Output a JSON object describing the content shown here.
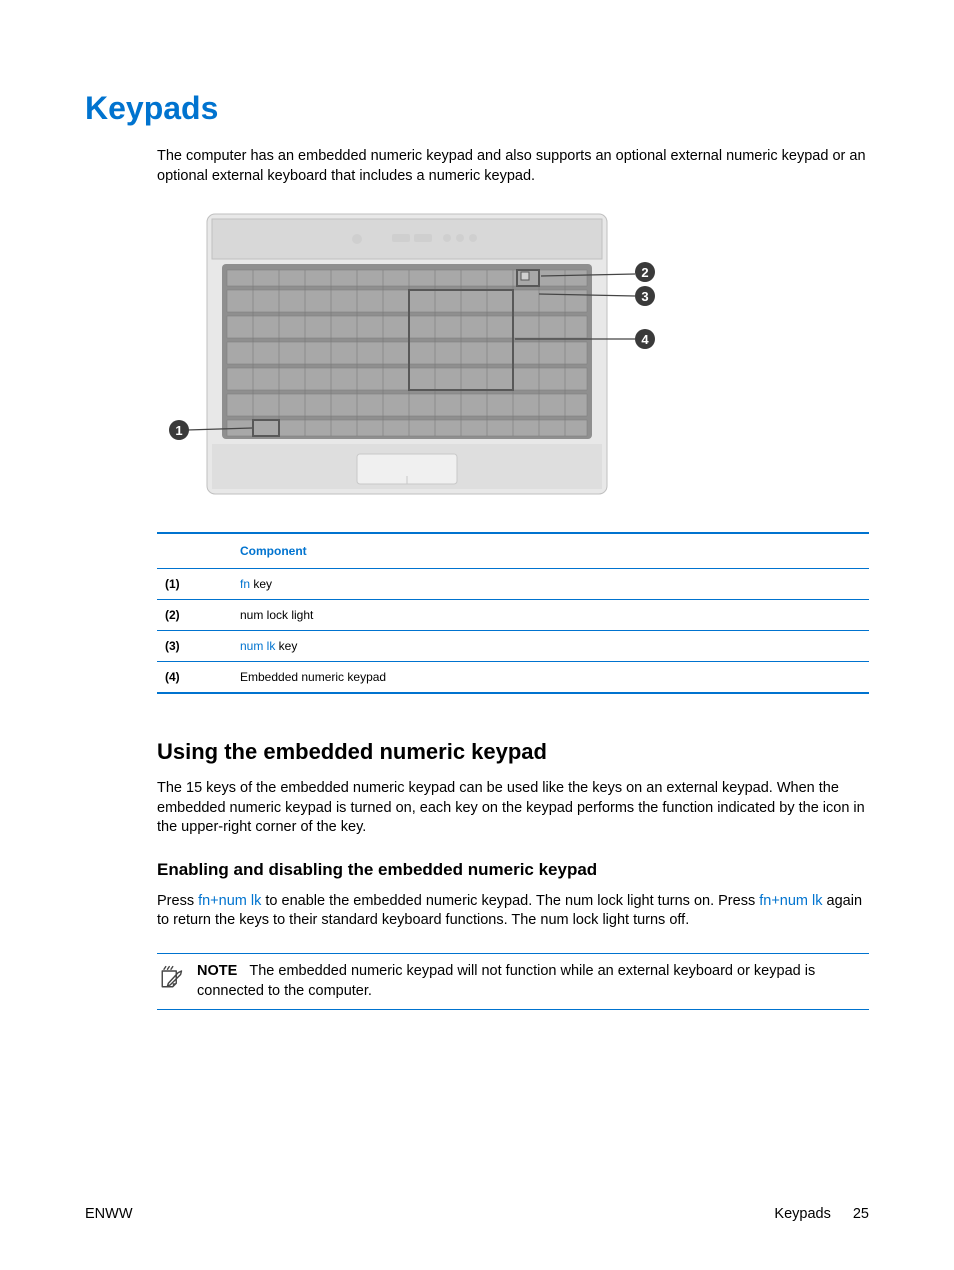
{
  "title": "Keypads",
  "intro": "The computer has an embedded numeric keypad and also supports an optional external numeric keypad or an optional external keyboard that includes a numeric keypad.",
  "table": {
    "header_blank": "",
    "header_component": "Component",
    "rows": [
      {
        "num": "(1)",
        "component_blue": "fn",
        "component_rest": " key"
      },
      {
        "num": "(2)",
        "component_blue": "",
        "component_rest": "num lock light"
      },
      {
        "num": "(3)",
        "component_blue": "num lk",
        "component_rest": " key"
      },
      {
        "num": "(4)",
        "component_blue": "",
        "component_rest": "Embedded numeric keypad"
      }
    ]
  },
  "h2": "Using the embedded numeric keypad",
  "p2": "The 15 keys of the embedded numeric keypad can be used like the keys on an external keypad. When the embedded numeric keypad is turned on, each key on the keypad performs the function indicated by the icon in the upper-right corner of the key.",
  "h3": "Enabling and disabling the embedded numeric keypad",
  "p3_parts": {
    "a": "Press ",
    "b": "fn+num lk",
    "c": " to enable the embedded numeric keypad. The num lock light turns on. Press ",
    "d": "fn+num lk",
    "e": " again to return the keys to their standard keyboard functions. The num lock light turns off."
  },
  "note": {
    "label": "NOTE",
    "text": "The embedded numeric keypad will not function while an external keyboard or keypad is connected to the computer."
  },
  "footer": {
    "left": "ENWW",
    "right_label": "Keypads",
    "page": "25"
  },
  "callouts": {
    "c1": "1",
    "c2": "2",
    "c3": "3",
    "c4": "4"
  }
}
